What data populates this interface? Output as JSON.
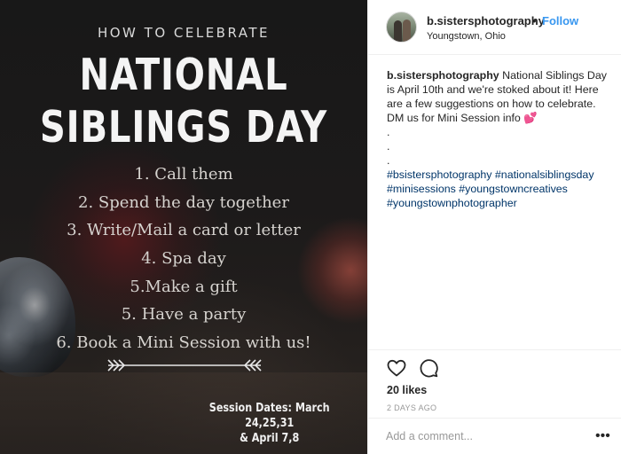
{
  "image": {
    "subtitle": "HOW TO CELEBRATE",
    "title_line1": "NATIONAL",
    "title_line2": "SIBLINGS DAY",
    "tips": [
      "1. Call them",
      "2. Spend the day together",
      "3. Write/Mail a card or letter",
      "4. Spa day",
      "5.Make a gift",
      "5. Have a party",
      "6. Book a Mini Session with us!"
    ],
    "session_line1": "Session Dates: March 24,25,31",
    "session_line2": "& April 7,8"
  },
  "header": {
    "username": "b.sistersphotography",
    "separator": "•",
    "follow_label": "Follow",
    "location": "Youngstown, Ohio",
    "accent_color": "#3897f0"
  },
  "caption": {
    "username": "b.sistersphotography",
    "text": "National Siblings Day is April 10th and we're stoked about it! Here are a few suggestions on how to celebrate. DM us for Mini Session info 💕",
    "dots": [
      ".",
      ".",
      "."
    ],
    "hashtags_line1": "#bsistersphotography #nationalsiblingsday",
    "hashtags_line2": "#minisessions #youngstowncreatives",
    "hashtags_line3": "#youngstownphotographer",
    "hashtag_color": "#003569"
  },
  "actions": {
    "icons": [
      "heart-icon",
      "comment-icon"
    ],
    "likes": "20 likes",
    "time_ago": "2 DAYS AGO"
  },
  "comment_box": {
    "placeholder": "Add a comment...",
    "more_label": "•••"
  }
}
